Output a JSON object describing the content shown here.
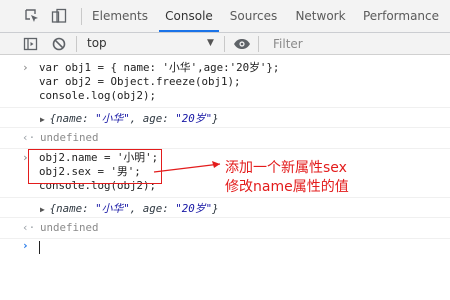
{
  "tabs": [
    "Elements",
    "Console",
    "Sources",
    "Network",
    "Performance"
  ],
  "toolbar": {
    "context": "top",
    "filter_placeholder": "Filter"
  },
  "console": {
    "block1": [
      "var obj1 = { name: '小华',age:'20岁'};",
      "var obj2 = Object.freeze(obj1);",
      "console.log(obj2);"
    ],
    "obj_output_1": {
      "prefix": "{name: ",
      "name": "\"小华\"",
      "mid": ", age: ",
      "age": "\"20岁\"",
      "suffix": "}"
    },
    "undefined_1": "undefined",
    "block2": [
      "obj2.name = '小明';",
      "obj2.sex = '男';",
      "console.log(obj2);"
    ],
    "obj_output_2": {
      "prefix": "{name: ",
      "name": "\"小华\"",
      "mid": ", age: ",
      "age": "\"20岁\"",
      "suffix": "}"
    },
    "undefined_2": "undefined"
  },
  "annotation": {
    "line1": "添加一个新属性sex",
    "line2": "修改name属性的值",
    "color": "#e31c1c"
  }
}
